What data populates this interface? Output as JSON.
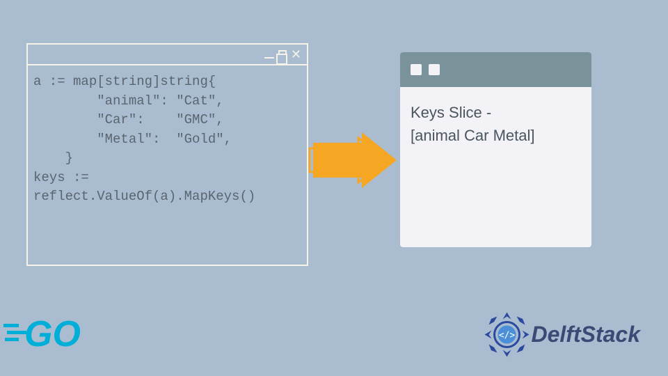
{
  "code_window": {
    "line1": "a := map[string]string{",
    "line2": "        \"animal\": \"Cat\",",
    "line3": "        \"Car\":    \"GMC\",",
    "line4": "        \"Metal\":  \"Gold\",",
    "line5": "    }",
    "line6": "keys :=",
    "line7": "reflect.ValueOf(a).MapKeys()"
  },
  "output_window": {
    "line1": "Keys Slice -",
    "line2": "[animal Car Metal]"
  },
  "logos": {
    "go": "GO",
    "delft": "DelftStack"
  },
  "colors": {
    "background": "#aabdd0",
    "code_border": "#f5f2e8",
    "code_text": "#5a6570",
    "arrow": "#f5a623",
    "output_bg": "#f2f2f7",
    "output_titlebar": "#7a939a",
    "output_text": "#4a5560",
    "go_logo": "#00aed8",
    "delft_primary": "#2b4a9e"
  }
}
